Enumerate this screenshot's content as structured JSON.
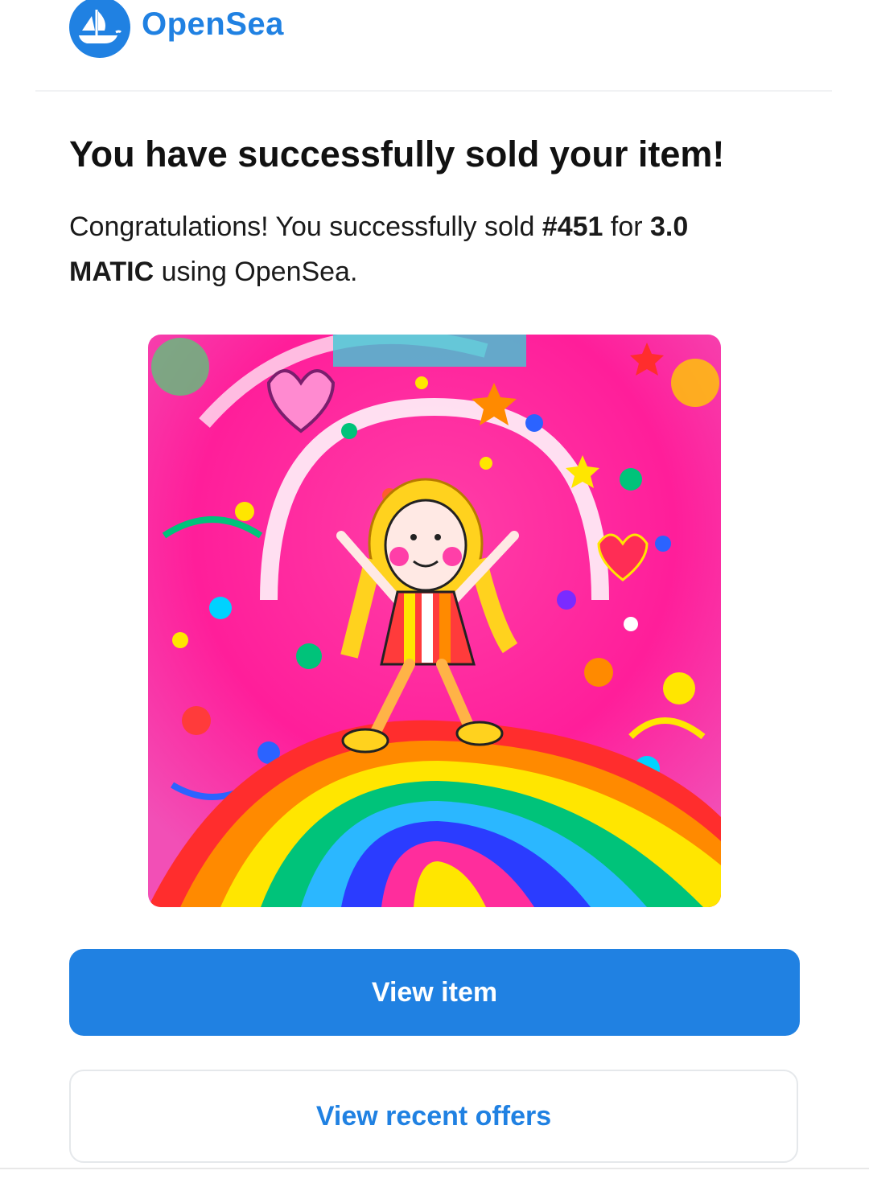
{
  "header": {
    "logo_icon": "opensea-boat-icon",
    "logo_text": "OpenSea",
    "brand_color": "#2081e2"
  },
  "headline": "You have successfully sold your item!",
  "message": {
    "prefix": "Congratulations! You successfully sold ",
    "item": "#451",
    "middle": " for ",
    "price": "3.0 MATIC",
    "suffix": " using OpenSea."
  },
  "artwork": {
    "description_icon": "nft-artwork-image"
  },
  "buttons": {
    "view_item": "View item",
    "view_offers": "View recent offers"
  }
}
